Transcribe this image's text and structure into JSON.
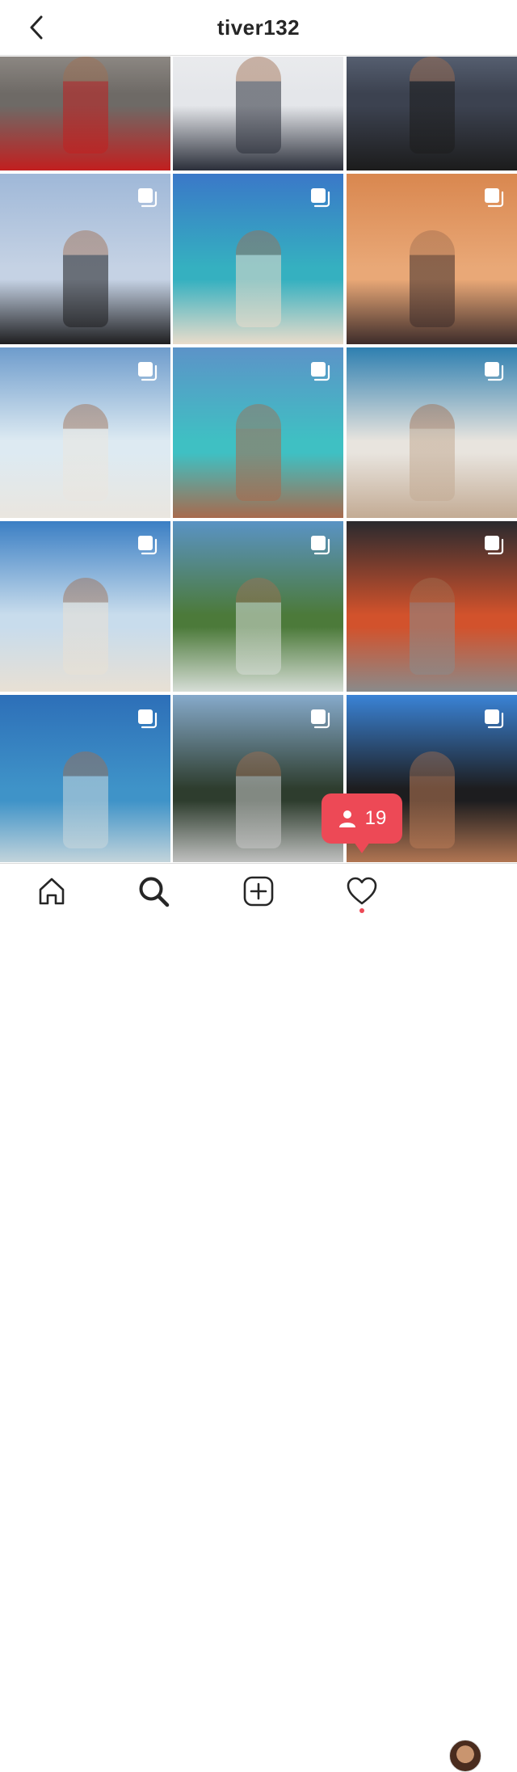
{
  "header": {
    "username": "tiver132",
    "back_icon": "chevron-left-icon"
  },
  "grid": {
    "columns": 3,
    "tiles": [
      {
        "scene": "man-holding-sphynx-cat-red-blanket",
        "multi": false,
        "colors": [
          "#b9b3ad",
          "#6e6a66",
          "#c21f1f"
        ]
      },
      {
        "scene": "man-in-snow-dark-jacket",
        "multi": false,
        "colors": [
          "#f2f2f2",
          "#e4e6ea",
          "#2b2f3a"
        ]
      },
      {
        "scene": "man-on-skyscraper-glass-deck",
        "multi": false,
        "colors": [
          "#7c8aa0",
          "#3c4250",
          "#1c1c1c"
        ]
      },
      {
        "scene": "selfie-beanie-headphones-city",
        "multi": true,
        "colors": [
          "#9fb8d8",
          "#c5d2e4",
          "#1e1e20"
        ]
      },
      {
        "scene": "beach-back-view-blue-water",
        "multi": true,
        "colors": [
          "#3a78c8",
          "#35b0c0",
          "#e9dccb"
        ]
      },
      {
        "scene": "sunset-beach-silhouette",
        "multi": true,
        "colors": [
          "#d9874f",
          "#e9a877",
          "#3d2c2a"
        ]
      },
      {
        "scene": "walking-on-white-beach",
        "multi": true,
        "colors": [
          "#6e9ccc",
          "#ddeaf2",
          "#eae6df"
        ]
      },
      {
        "scene": "shaka-selfie-beach",
        "multi": true,
        "colors": [
          "#5c93c8",
          "#3fc0c3",
          "#a86a4d"
        ]
      },
      {
        "scene": "lying-on-sand-waves",
        "multi": true,
        "colors": [
          "#2e7fb0",
          "#e8e4de",
          "#c3ab94"
        ]
      },
      {
        "scene": "breakdance-freeze-beach",
        "multi": true,
        "colors": [
          "#3b7fc4",
          "#c8dcec",
          "#e8e0d4"
        ]
      },
      {
        "scene": "standing-in-shallow-water-hills",
        "multi": true,
        "colors": [
          "#5a93c4",
          "#4c7a3a",
          "#d6ddd6"
        ]
      },
      {
        "scene": "gym-mirror-selfie-orange-machines",
        "multi": true,
        "colors": [
          "#2a2a2e",
          "#d2522c",
          "#8a8a8a"
        ]
      },
      {
        "scene": "standing-in-sea-blue-sky",
        "multi": true,
        "colors": [
          "#2d6fb8",
          "#3f93c8",
          "#c9d7dc"
        ]
      },
      {
        "scene": "holding-baby-mountain-lake",
        "multi": true,
        "colors": [
          "#86aacb",
          "#2e3d2e",
          "#c7c7c7"
        ]
      },
      {
        "scene": "selfie-headphones-black-shirt",
        "multi": true,
        "colors": [
          "#3a83d6",
          "#1d1d1f",
          "#b97a55"
        ]
      }
    ]
  },
  "notification_badge": {
    "icon": "person-icon",
    "count": "19"
  },
  "tabbar": {
    "items": [
      {
        "name": "home",
        "icon": "home-icon"
      },
      {
        "name": "search",
        "icon": "search-icon"
      },
      {
        "name": "new-post",
        "icon": "plus-square-icon"
      },
      {
        "name": "activity",
        "icon": "heart-icon",
        "has_dot": true
      },
      {
        "name": "profile",
        "icon": "avatar"
      }
    ]
  },
  "colors": {
    "accent": "#ed4956",
    "border": "#dbdbdb",
    "text": "#262626"
  }
}
